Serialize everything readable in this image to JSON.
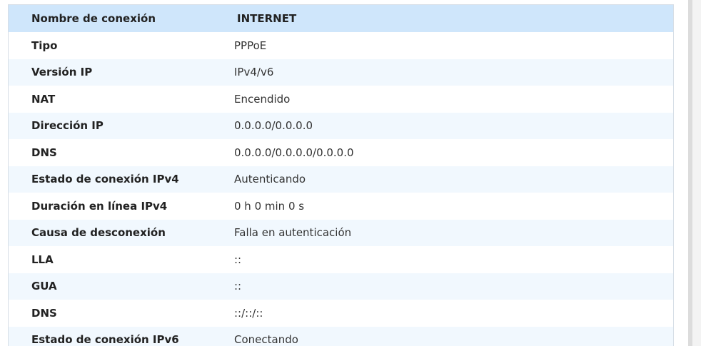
{
  "connection_table": {
    "header": {
      "key": "Nombre de conexión",
      "value": "INTERNET"
    },
    "rows": [
      {
        "key": "Tipo",
        "value": "PPPoE"
      },
      {
        "key": "Versión IP",
        "value": "IPv4/v6"
      },
      {
        "key": "NAT",
        "value": "Encendido"
      },
      {
        "key": "Dirección IP",
        "value": "0.0.0.0/0.0.0.0"
      },
      {
        "key": "DNS",
        "value": "0.0.0.0/0.0.0.0/0.0.0.0"
      },
      {
        "key": "Estado de conexión IPv4",
        "value": "Autenticando"
      },
      {
        "key": "Duración en línea IPv4",
        "value": "0 h 0 min 0 s"
      },
      {
        "key": "Causa de desconexión",
        "value": "Falla en autenticación"
      },
      {
        "key": "LLA",
        "value": "::"
      },
      {
        "key": "GUA",
        "value": "::"
      },
      {
        "key": "DNS",
        "value": "::/::/::"
      },
      {
        "key": "Estado de conexión IPv6",
        "value": "Conectando"
      }
    ]
  },
  "colors": {
    "header_bg": "#cfe6fb",
    "alt_row_bg": "#f1f8fe",
    "border": "#d6dee6"
  }
}
